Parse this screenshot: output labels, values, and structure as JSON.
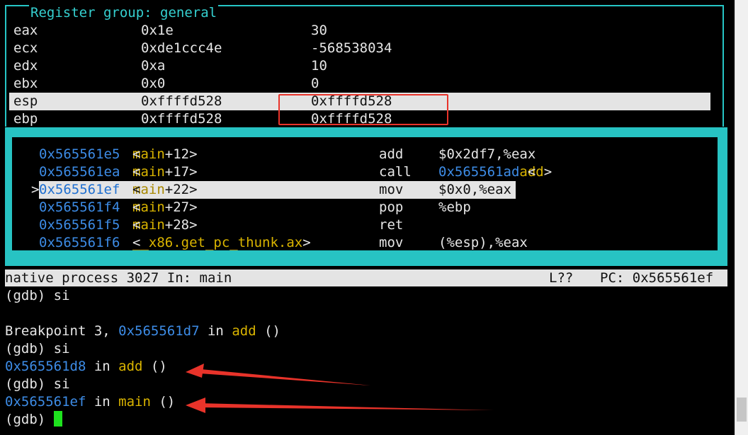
{
  "register_panel": {
    "title": "Register group: general",
    "rows": [
      {
        "name": "eax",
        "hex": "0x1e",
        "natural": "30"
      },
      {
        "name": "ecx",
        "hex": "0xde1ccc4e",
        "natural": "-568538034"
      },
      {
        "name": "edx",
        "hex": "0xa",
        "natural": "10"
      },
      {
        "name": "ebx",
        "hex": "0x0",
        "natural": "0"
      },
      {
        "name": "esp",
        "hex": "0xffffd528",
        "natural": "0xffffd528"
      },
      {
        "name": "ebp",
        "hex": "0xffffd528",
        "natural": "0xffffd528"
      }
    ]
  },
  "asm_panel": {
    "rows": [
      {
        "marker": "",
        "addr": "0x565561e5",
        "sym_pre": "<",
        "sym_fn": "main",
        "sym_post": "+12>",
        "op": "add",
        "arg": "$0x2df7,%eax"
      },
      {
        "marker": "",
        "addr": "0x565561ea",
        "sym_pre": "<",
        "sym_fn": "main",
        "sym_post": "+17>",
        "op": "call",
        "arg_addr": "0x565561ad",
        "arg_pre": " <",
        "arg_fn": "add",
        "arg_post": ">"
      },
      {
        "marker": ">",
        "addr": "0x565561ef",
        "sym_pre": "<",
        "sym_fn": "main",
        "sym_post": "+22>",
        "op": "mov",
        "arg": "$0x0,%eax"
      },
      {
        "marker": "",
        "addr": "0x565561f4",
        "sym_pre": "<",
        "sym_fn": "main",
        "sym_post": "+27>",
        "op": "pop",
        "arg": "%ebp"
      },
      {
        "marker": "",
        "addr": "0x565561f5",
        "sym_pre": "<",
        "sym_fn": "main",
        "sym_post": "+28>",
        "op": "ret",
        "arg": ""
      },
      {
        "marker": "",
        "addr": "0x565561f6",
        "sym_pre": "<",
        "sym_fn": "__x86.get_pc_thunk.ax",
        "sym_post": ">",
        "op": "mov",
        "arg": "(%esp),%eax"
      }
    ]
  },
  "status_bar": {
    "process": "native process 3027 In: main",
    "line": "L??",
    "pc": "PC: 0x565561ef"
  },
  "command_area": {
    "lines": [
      {
        "prompt": "(gdb) si"
      },
      {
        "blank": ""
      },
      {
        "pre": "Breakpoint 3, ",
        "addr": "0x565561d7",
        "mid": " in ",
        "fn": "add",
        "post": " ()"
      },
      {
        "prompt": "(gdb) si"
      },
      {
        "addr": "0x565561d8",
        "mid": " in ",
        "fn": "add",
        "post": " ()"
      },
      {
        "prompt": "(gdb) si"
      },
      {
        "addr": "0x565561ef",
        "mid": " in ",
        "fn": "main",
        "post": " ()"
      },
      {
        "prompt": "(gdb) "
      }
    ]
  },
  "colors": {
    "border_cyan": "#27c3c3",
    "address_blue": "#3d8ce6",
    "function_yellow": "#d9b400",
    "highlight_bg": "#e4e4e4",
    "annotation_red": "#e8332a",
    "cursor_green": "#1ee21e"
  }
}
